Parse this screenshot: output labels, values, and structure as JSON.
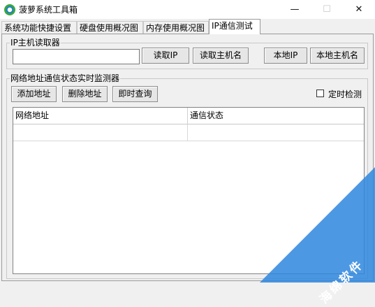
{
  "window": {
    "title": "菠萝系统工具箱",
    "minimize": "—",
    "maximize": "☐",
    "close": "✕"
  },
  "tabs": [
    {
      "label": "系统功能快捷设置"
    },
    {
      "label": "硬盘使用概况图"
    },
    {
      "label": "内存使用概况图"
    },
    {
      "label": "IP通信测试",
      "active": true
    }
  ],
  "ip_reader": {
    "legend": "IP主机读取器",
    "ip_input_value": "",
    "read_ip": "读取IP",
    "read_hostname": "读取主机名",
    "local_ip": "本地IP",
    "local_hostname": "本地主机名"
  },
  "monitor": {
    "legend": "网络地址通信状态实时监测器",
    "add_address": "添加地址",
    "delete_address": "删除地址",
    "query_now": "即时查询",
    "timed_check_label": "定时检测",
    "timed_check_checked": false,
    "columns": [
      "网络地址",
      "通信状态"
    ]
  },
  "watermark": {
    "text": "海绵软件",
    "color": "#2e86de"
  }
}
